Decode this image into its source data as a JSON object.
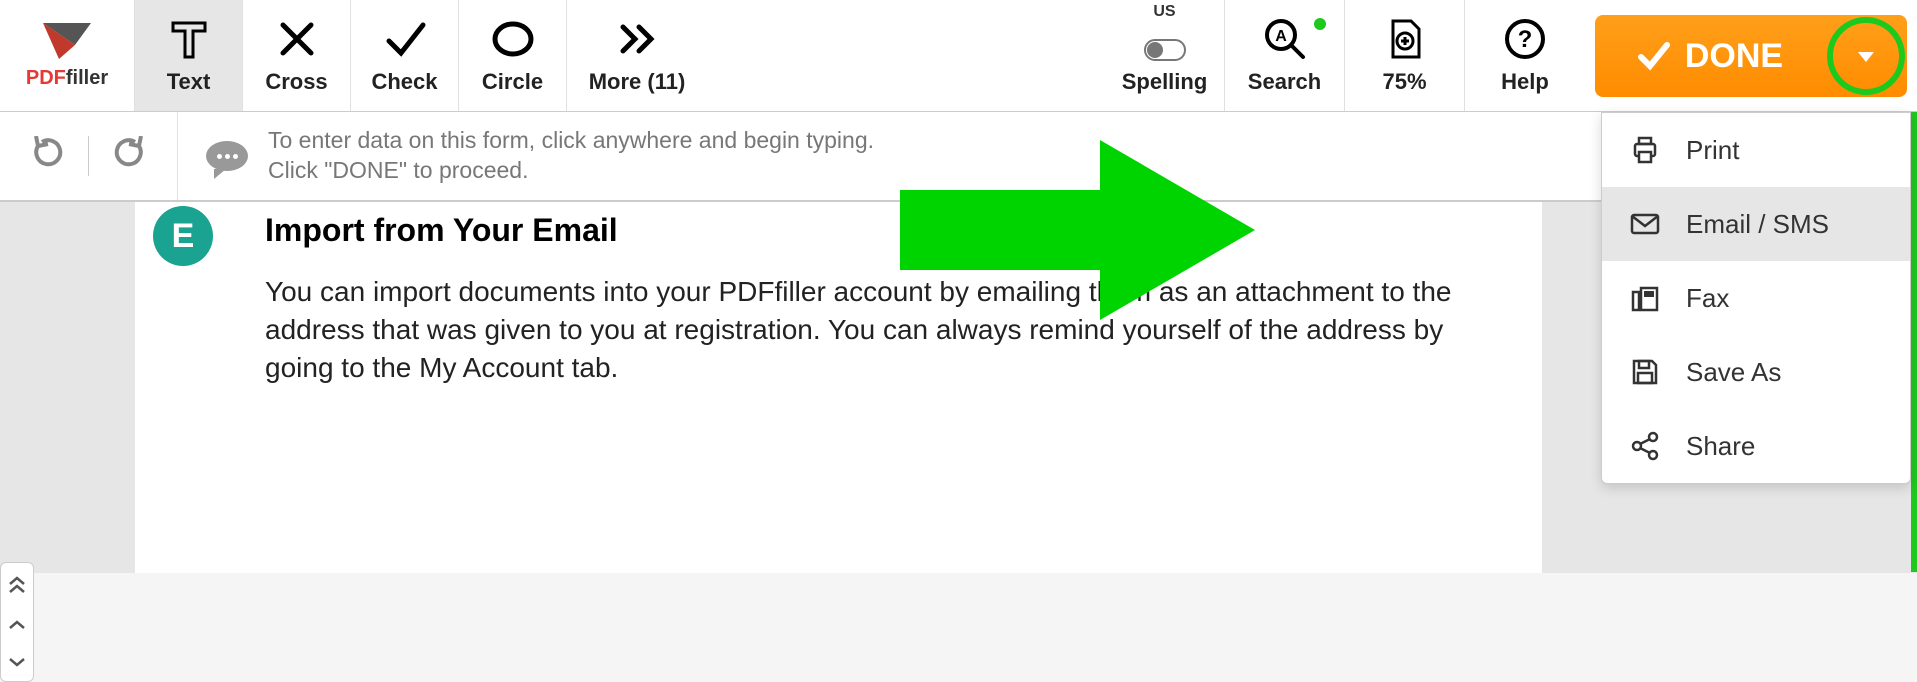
{
  "brand": {
    "pdf": "PDF",
    "filler": "filler"
  },
  "toolbar": {
    "text": "Text",
    "cross": "Cross",
    "check": "Check",
    "circle": "Circle",
    "more": "More (11)",
    "spelling": "Spelling",
    "spelling_lang": "US",
    "search": "Search",
    "zoom": "75%",
    "help": "Help",
    "done": "DONE"
  },
  "info": {
    "line1": "To enter data on this form, click anywhere and begin typing.",
    "line2": "Click \"DONE\" to proceed."
  },
  "doc": {
    "avatar_letter": "E",
    "title": "Import from Your Email",
    "body": "You can import documents into your PDFfiller account by emailing them as an attachment to the address that was given to you at registration. You can always remind yourself of the address by going to the My Account tab."
  },
  "dropdown": {
    "print": "Print",
    "email": "Email / SMS",
    "fax": "Fax",
    "save_as": "Save As",
    "share": "Share"
  }
}
